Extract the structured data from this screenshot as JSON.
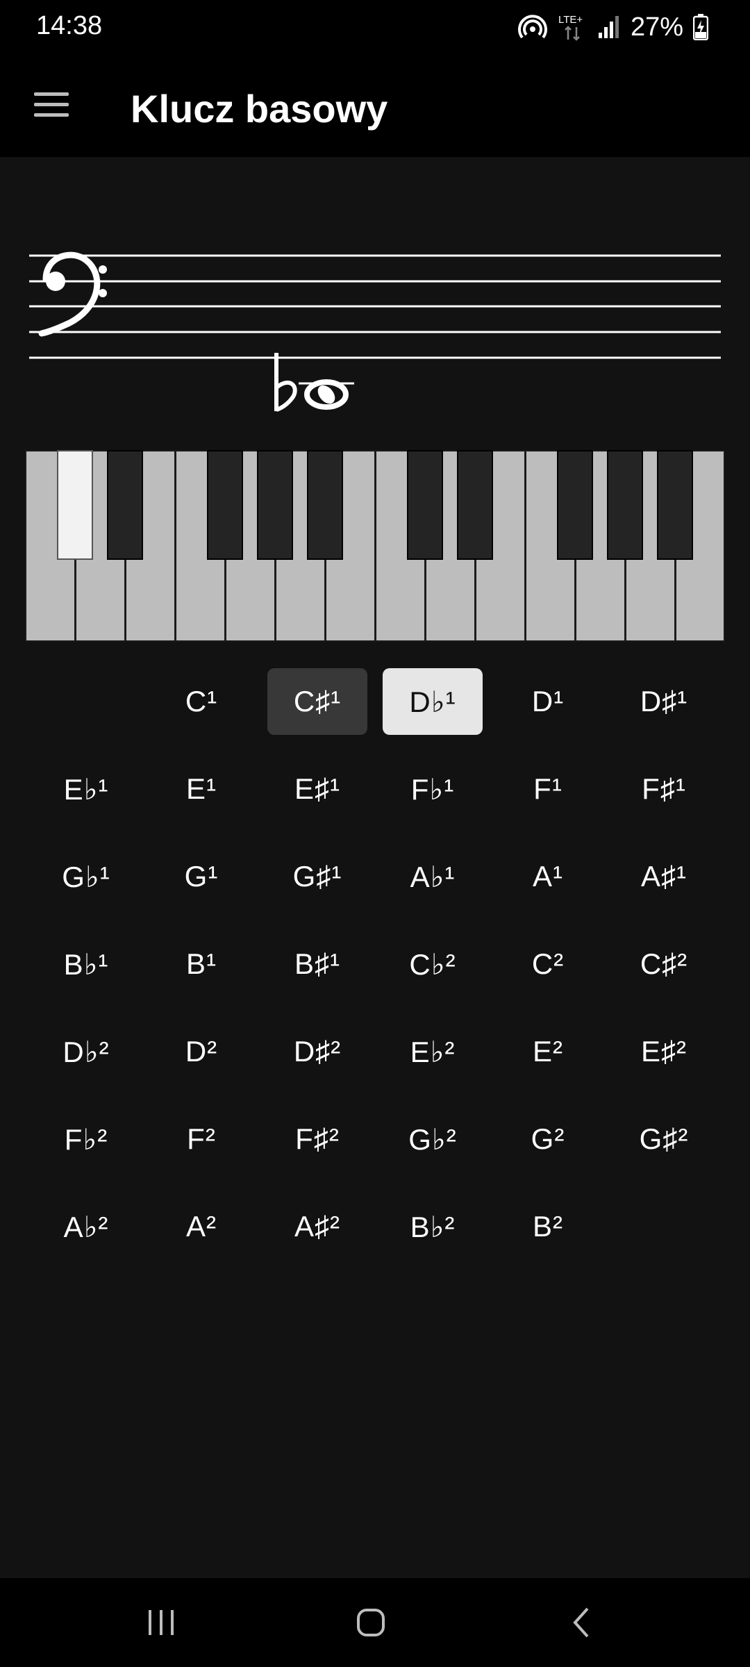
{
  "status_bar": {
    "time": "14:38",
    "network": "LTE+",
    "battery": "27%",
    "icons": [
      "hotspot-icon",
      "lte-icon",
      "signal-icon",
      "battery-charging-icon"
    ]
  },
  "app_bar": {
    "title": "Klucz basowy",
    "menu_icon": "hamburger-menu-icon"
  },
  "staff": {
    "clef": "bass",
    "note": "D♭¹",
    "accidental": "flat"
  },
  "piano": {
    "white_key_count": 14,
    "black_keys": [
      "C#1",
      "D#1",
      "F#1",
      "G#1",
      "A#1",
      "C#2",
      "D#2",
      "F#2",
      "G#2",
      "A#2"
    ],
    "highlighted_key": "C#1"
  },
  "notes": [
    [
      "",
      "C¹",
      "C♯¹",
      "D♭¹",
      "D¹",
      "D♯¹"
    ],
    [
      "E♭¹",
      "E¹",
      "E♯¹",
      "F♭¹",
      "F¹",
      "F♯¹"
    ],
    [
      "G♭¹",
      "G¹",
      "G♯¹",
      "A♭¹",
      "A¹",
      "A♯¹"
    ],
    [
      "B♭¹",
      "B¹",
      "B♯¹",
      "C♭²",
      "C²",
      "C♯²"
    ],
    [
      "D♭²",
      "D²",
      "D♯²",
      "E♭²",
      "E²",
      "E♯²"
    ],
    [
      "F♭²",
      "F²",
      "F♯²",
      "G♭²",
      "G²",
      "G♯²"
    ],
    [
      "A♭²",
      "A²",
      "A♯²",
      "B♭²",
      "B²",
      ""
    ]
  ],
  "selected_note": "D♭¹",
  "hovered_note": "C♯¹",
  "colors": {
    "background": "#121212",
    "bar": "#000000",
    "white_key": "#bdbdbd",
    "black_key": "#242424",
    "active_key": "#f2f2f2",
    "selected_note_bg": "#e6e6e6",
    "hover_note_bg": "#383838"
  },
  "nav_bar": {
    "recents_icon": "recents-icon",
    "home_icon": "home-icon",
    "back_icon": "back-icon"
  }
}
